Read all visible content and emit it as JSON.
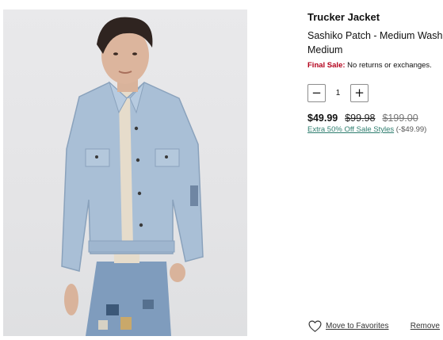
{
  "product": {
    "title": "Trucker Jacket",
    "subtitle": "Sashiko Patch - Medium Wash",
    "size": "Medium",
    "final_sale_label": "Final Sale:",
    "final_sale_text": "No returns or exchanges.",
    "quantity": "1",
    "minus_symbol": "−",
    "plus_symbol": "+",
    "price_current": "$49.99",
    "price_previous": "$99.98",
    "price_original": "$199.00",
    "promo_text": "Extra 50% Off Sale Styles",
    "promo_savings": "(-$49.99)"
  },
  "actions": {
    "move_to_favorites": "Move to Favorites",
    "remove": "Remove"
  },
  "icons": {
    "favorite": "heart-outline-icon"
  },
  "colors": {
    "final_sale": "#b3001b",
    "promo_link": "#2e7d6e",
    "denim": "#a9bfd6"
  }
}
